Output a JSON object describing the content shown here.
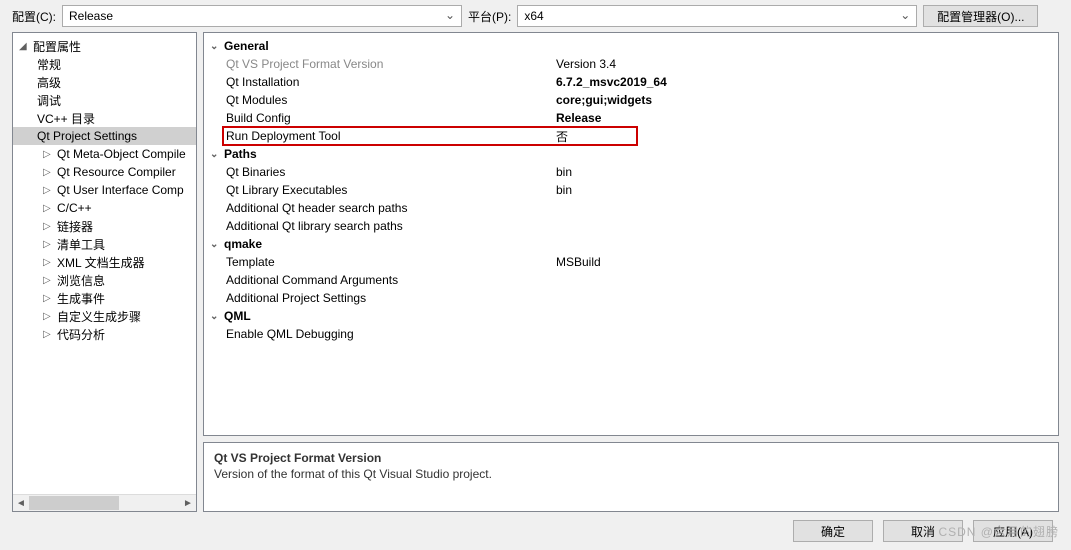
{
  "toolbar": {
    "config_label": "配置(C):",
    "config_value": "Release",
    "platform_label": "平台(P):",
    "platform_value": "x64",
    "manager_button": "配置管理器(O)..."
  },
  "tree": {
    "root": "配置属性",
    "items": [
      {
        "label": "常规",
        "expander": ""
      },
      {
        "label": "高级",
        "expander": ""
      },
      {
        "label": "调试",
        "expander": ""
      },
      {
        "label": "VC++ 目录",
        "expander": ""
      },
      {
        "label": "Qt Project Settings",
        "expander": "",
        "selected": true
      },
      {
        "label": "Qt Meta-Object Compile",
        "expander": "▷"
      },
      {
        "label": "Qt Resource Compiler",
        "expander": "▷"
      },
      {
        "label": "Qt User Interface Comp",
        "expander": "▷"
      },
      {
        "label": "C/C++",
        "expander": "▷"
      },
      {
        "label": "链接器",
        "expander": "▷"
      },
      {
        "label": "清单工具",
        "expander": "▷"
      },
      {
        "label": "XML 文档生成器",
        "expander": "▷"
      },
      {
        "label": "浏览信息",
        "expander": "▷"
      },
      {
        "label": "生成事件",
        "expander": "▷"
      },
      {
        "label": "自定义生成步骤",
        "expander": "▷"
      },
      {
        "label": "代码分析",
        "expander": "▷"
      }
    ]
  },
  "groups": [
    {
      "name": "General",
      "rows": [
        {
          "label": "Qt VS Project Format Version",
          "value": "Version 3.4",
          "disabled": true
        },
        {
          "label": "Qt Installation",
          "value": "6.7.2_msvc2019_64",
          "bold": true
        },
        {
          "label": "Qt Modules",
          "value": "core;gui;widgets",
          "bold": true
        },
        {
          "label": "Build Config",
          "value": "Release",
          "bold": true
        },
        {
          "label": "Run Deployment Tool",
          "value": "否",
          "highlighted": true
        }
      ]
    },
    {
      "name": "Paths",
      "rows": [
        {
          "label": "Qt Binaries",
          "value": "bin"
        },
        {
          "label": "Qt Library Executables",
          "value": "bin"
        },
        {
          "label": "Additional Qt header search paths",
          "value": ""
        },
        {
          "label": "Additional Qt library search paths",
          "value": ""
        }
      ]
    },
    {
      "name": "qmake",
      "rows": [
        {
          "label": "Template",
          "value": "MSBuild"
        },
        {
          "label": "Additional Command Arguments",
          "value": ""
        },
        {
          "label": "Additional Project Settings",
          "value": ""
        }
      ]
    },
    {
      "name": "QML",
      "rows": [
        {
          "label": "Enable QML Debugging",
          "value": ""
        }
      ]
    }
  ],
  "description": {
    "title": "Qt VS Project Format Version",
    "text": "Version of the format of this Qt Visual Studio project."
  },
  "footer": {
    "ok": "确定",
    "cancel": "取消",
    "apply": "应用(A)"
  },
  "watermark": "CSDN @六月的翅膀"
}
